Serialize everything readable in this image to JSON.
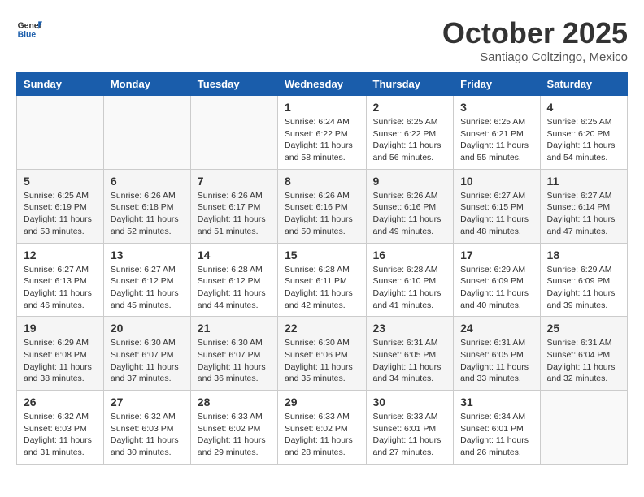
{
  "header": {
    "logo_general": "General",
    "logo_blue": "Blue",
    "month_title": "October 2025",
    "location": "Santiago Coltzingo, Mexico"
  },
  "weekdays": [
    "Sunday",
    "Monday",
    "Tuesday",
    "Wednesday",
    "Thursday",
    "Friday",
    "Saturday"
  ],
  "weeks": [
    [
      {
        "day": "",
        "sunrise": "",
        "sunset": "",
        "daylight": ""
      },
      {
        "day": "",
        "sunrise": "",
        "sunset": "",
        "daylight": ""
      },
      {
        "day": "",
        "sunrise": "",
        "sunset": "",
        "daylight": ""
      },
      {
        "day": "1",
        "sunrise": "Sunrise: 6:24 AM",
        "sunset": "Sunset: 6:22 PM",
        "daylight": "Daylight: 11 hours and 58 minutes."
      },
      {
        "day": "2",
        "sunrise": "Sunrise: 6:25 AM",
        "sunset": "Sunset: 6:22 PM",
        "daylight": "Daylight: 11 hours and 56 minutes."
      },
      {
        "day": "3",
        "sunrise": "Sunrise: 6:25 AM",
        "sunset": "Sunset: 6:21 PM",
        "daylight": "Daylight: 11 hours and 55 minutes."
      },
      {
        "day": "4",
        "sunrise": "Sunrise: 6:25 AM",
        "sunset": "Sunset: 6:20 PM",
        "daylight": "Daylight: 11 hours and 54 minutes."
      }
    ],
    [
      {
        "day": "5",
        "sunrise": "Sunrise: 6:25 AM",
        "sunset": "Sunset: 6:19 PM",
        "daylight": "Daylight: 11 hours and 53 minutes."
      },
      {
        "day": "6",
        "sunrise": "Sunrise: 6:26 AM",
        "sunset": "Sunset: 6:18 PM",
        "daylight": "Daylight: 11 hours and 52 minutes."
      },
      {
        "day": "7",
        "sunrise": "Sunrise: 6:26 AM",
        "sunset": "Sunset: 6:17 PM",
        "daylight": "Daylight: 11 hours and 51 minutes."
      },
      {
        "day": "8",
        "sunrise": "Sunrise: 6:26 AM",
        "sunset": "Sunset: 6:16 PM",
        "daylight": "Daylight: 11 hours and 50 minutes."
      },
      {
        "day": "9",
        "sunrise": "Sunrise: 6:26 AM",
        "sunset": "Sunset: 6:16 PM",
        "daylight": "Daylight: 11 hours and 49 minutes."
      },
      {
        "day": "10",
        "sunrise": "Sunrise: 6:27 AM",
        "sunset": "Sunset: 6:15 PM",
        "daylight": "Daylight: 11 hours and 48 minutes."
      },
      {
        "day": "11",
        "sunrise": "Sunrise: 6:27 AM",
        "sunset": "Sunset: 6:14 PM",
        "daylight": "Daylight: 11 hours and 47 minutes."
      }
    ],
    [
      {
        "day": "12",
        "sunrise": "Sunrise: 6:27 AM",
        "sunset": "Sunset: 6:13 PM",
        "daylight": "Daylight: 11 hours and 46 minutes."
      },
      {
        "day": "13",
        "sunrise": "Sunrise: 6:27 AM",
        "sunset": "Sunset: 6:12 PM",
        "daylight": "Daylight: 11 hours and 45 minutes."
      },
      {
        "day": "14",
        "sunrise": "Sunrise: 6:28 AM",
        "sunset": "Sunset: 6:12 PM",
        "daylight": "Daylight: 11 hours and 44 minutes."
      },
      {
        "day": "15",
        "sunrise": "Sunrise: 6:28 AM",
        "sunset": "Sunset: 6:11 PM",
        "daylight": "Daylight: 11 hours and 42 minutes."
      },
      {
        "day": "16",
        "sunrise": "Sunrise: 6:28 AM",
        "sunset": "Sunset: 6:10 PM",
        "daylight": "Daylight: 11 hours and 41 minutes."
      },
      {
        "day": "17",
        "sunrise": "Sunrise: 6:29 AM",
        "sunset": "Sunset: 6:09 PM",
        "daylight": "Daylight: 11 hours and 40 minutes."
      },
      {
        "day": "18",
        "sunrise": "Sunrise: 6:29 AM",
        "sunset": "Sunset: 6:09 PM",
        "daylight": "Daylight: 11 hours and 39 minutes."
      }
    ],
    [
      {
        "day": "19",
        "sunrise": "Sunrise: 6:29 AM",
        "sunset": "Sunset: 6:08 PM",
        "daylight": "Daylight: 11 hours and 38 minutes."
      },
      {
        "day": "20",
        "sunrise": "Sunrise: 6:30 AM",
        "sunset": "Sunset: 6:07 PM",
        "daylight": "Daylight: 11 hours and 37 minutes."
      },
      {
        "day": "21",
        "sunrise": "Sunrise: 6:30 AM",
        "sunset": "Sunset: 6:07 PM",
        "daylight": "Daylight: 11 hours and 36 minutes."
      },
      {
        "day": "22",
        "sunrise": "Sunrise: 6:30 AM",
        "sunset": "Sunset: 6:06 PM",
        "daylight": "Daylight: 11 hours and 35 minutes."
      },
      {
        "day": "23",
        "sunrise": "Sunrise: 6:31 AM",
        "sunset": "Sunset: 6:05 PM",
        "daylight": "Daylight: 11 hours and 34 minutes."
      },
      {
        "day": "24",
        "sunrise": "Sunrise: 6:31 AM",
        "sunset": "Sunset: 6:05 PM",
        "daylight": "Daylight: 11 hours and 33 minutes."
      },
      {
        "day": "25",
        "sunrise": "Sunrise: 6:31 AM",
        "sunset": "Sunset: 6:04 PM",
        "daylight": "Daylight: 11 hours and 32 minutes."
      }
    ],
    [
      {
        "day": "26",
        "sunrise": "Sunrise: 6:32 AM",
        "sunset": "Sunset: 6:03 PM",
        "daylight": "Daylight: 11 hours and 31 minutes."
      },
      {
        "day": "27",
        "sunrise": "Sunrise: 6:32 AM",
        "sunset": "Sunset: 6:03 PM",
        "daylight": "Daylight: 11 hours and 30 minutes."
      },
      {
        "day": "28",
        "sunrise": "Sunrise: 6:33 AM",
        "sunset": "Sunset: 6:02 PM",
        "daylight": "Daylight: 11 hours and 29 minutes."
      },
      {
        "day": "29",
        "sunrise": "Sunrise: 6:33 AM",
        "sunset": "Sunset: 6:02 PM",
        "daylight": "Daylight: 11 hours and 28 minutes."
      },
      {
        "day": "30",
        "sunrise": "Sunrise: 6:33 AM",
        "sunset": "Sunset: 6:01 PM",
        "daylight": "Daylight: 11 hours and 27 minutes."
      },
      {
        "day": "31",
        "sunrise": "Sunrise: 6:34 AM",
        "sunset": "Sunset: 6:01 PM",
        "daylight": "Daylight: 11 hours and 26 minutes."
      },
      {
        "day": "",
        "sunrise": "",
        "sunset": "",
        "daylight": ""
      }
    ]
  ]
}
